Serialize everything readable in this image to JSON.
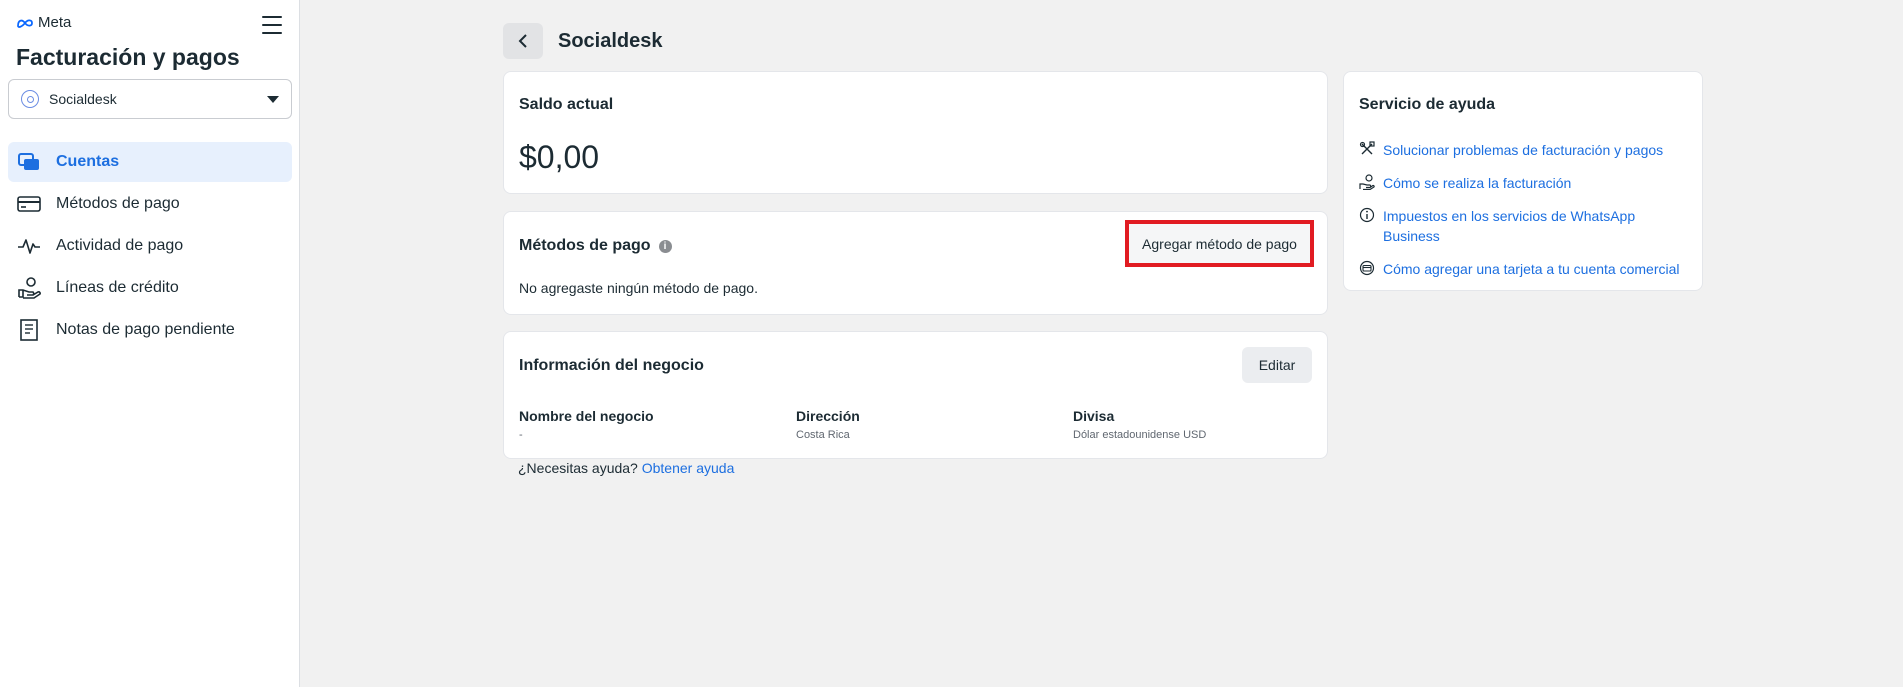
{
  "brand": {
    "name": "Meta"
  },
  "sidebar": {
    "title": "Facturación y pagos",
    "account": "Socialdesk",
    "items": [
      {
        "label": "Cuentas",
        "icon": "accounts-icon",
        "active": true
      },
      {
        "label": "Métodos de pago",
        "icon": "credit-card-icon",
        "active": false
      },
      {
        "label": "Actividad de pago",
        "icon": "activity-pulse-icon",
        "active": false
      },
      {
        "label": "Líneas de crédito",
        "icon": "credit-line-icon",
        "active": false
      },
      {
        "label": "Notas de pago pendiente",
        "icon": "receipt-icon",
        "active": false
      }
    ]
  },
  "header": {
    "title": "Socialdesk"
  },
  "balance": {
    "title": "Saldo actual",
    "amount": "$0,00"
  },
  "payment_methods": {
    "title": "Métodos de pago",
    "add_button": "Agregar método de pago",
    "empty_text": "No agregaste ningún método de pago."
  },
  "business": {
    "title": "Información del negocio",
    "edit_button": "Editar",
    "fields": [
      {
        "label": "Nombre del negocio",
        "value": "-"
      },
      {
        "label": "Dirección",
        "value": "Costa Rica"
      },
      {
        "label": "Divisa",
        "value": "Dólar estadounidense USD"
      }
    ]
  },
  "help_prompt": {
    "text": "¿Necesitas ayuda?",
    "link": "Obtener ayuda"
  },
  "help_center": {
    "title": "Servicio de ayuda",
    "links": [
      {
        "label": "Solucionar problemas de facturación y pagos",
        "icon": "tools-icon"
      },
      {
        "label": "Cómo se realiza la facturación",
        "icon": "hand-coin-icon"
      },
      {
        "label": "Impuestos en los servicios de WhatsApp Business",
        "icon": "info-icon"
      },
      {
        "label": "Cómo agregar una tarjeta a tu cuenta comercial",
        "icon": "card-circle-icon"
      }
    ]
  },
  "colors": {
    "accent": "#1d6fe0",
    "highlight_border": "#e11b22",
    "active_bg": "#e7f0fd"
  }
}
